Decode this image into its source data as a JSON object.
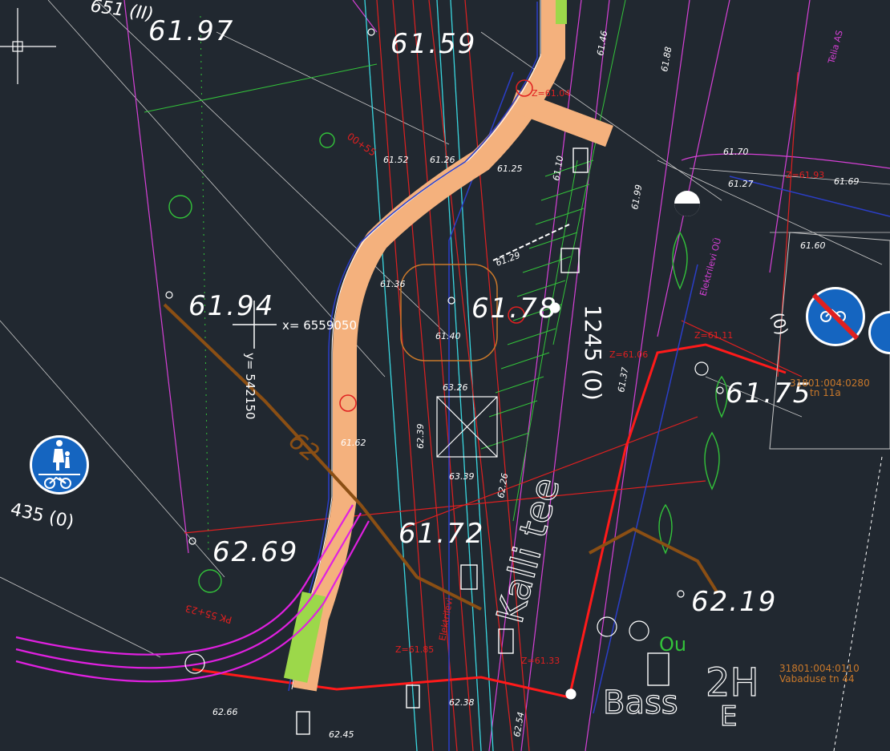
{
  "elevations": {
    "e1": "61.97",
    "e2": "61.59",
    "e3": "61.94",
    "e4": "61.75",
    "e5": "61.72",
    "e6": "62.69",
    "e7": "62.19",
    "e8": "61.78"
  },
  "coords": {
    "x": "x=  6559050",
    "y": "y=  542150"
  },
  "contour_label": "62",
  "road_codes": {
    "r1": "435 (0)",
    "r2": "651 (II)",
    "r3": "1245 (0)",
    "r4": "(0)"
  },
  "street_label": "Kalli tee",
  "parcels": {
    "p1_id": "31801:004:0110",
    "p1_addr": "Vabaduse tn 44",
    "p2_id": "31801:004:0280",
    "p2_addr": "tn 11a"
  },
  "big_labels": {
    "b1": "2H",
    "b2": "Bass",
    "b3": "E"
  },
  "z_labels": [
    "Z=61.04",
    "Z=61.06",
    "Z=61.11",
    "Z=61.93",
    "Z=61.33",
    "Z=61.85"
  ],
  "small_levels": [
    "61.52",
    "61.26",
    "61.25",
    "61.36",
    "61.40",
    "63.26",
    "63.39",
    "61.62",
    "62.39",
    "61.10",
    "61.29",
    "61.70",
    "61.27",
    "61.60",
    "61.69",
    "61.99",
    "61.37",
    "62.26",
    "62.54",
    "62.38",
    "62.45",
    "62.66",
    "61.46",
    "61.88"
  ],
  "utility_labels": {
    "u1": "Telia AS",
    "u2": "Elektrilevi OÜ",
    "u3": "Elektrilevi"
  },
  "chainage": "00+55",
  "pk_label": "PK 55+23",
  "ou_label": "Ou",
  "colors": {
    "background": "#212830",
    "bike_path": "#f4b17d",
    "contour": "#8b4f14",
    "utility_red": "#e02020",
    "magenta": "#d640d6",
    "cyan": "#3ad7e0",
    "green": "#33c33a",
    "sign_blue": "#1565c0"
  },
  "icons": [
    "pedestrian-cycle-sign-icon",
    "no-cycling-sign-icon",
    "crosshair-cursor-icon"
  ]
}
